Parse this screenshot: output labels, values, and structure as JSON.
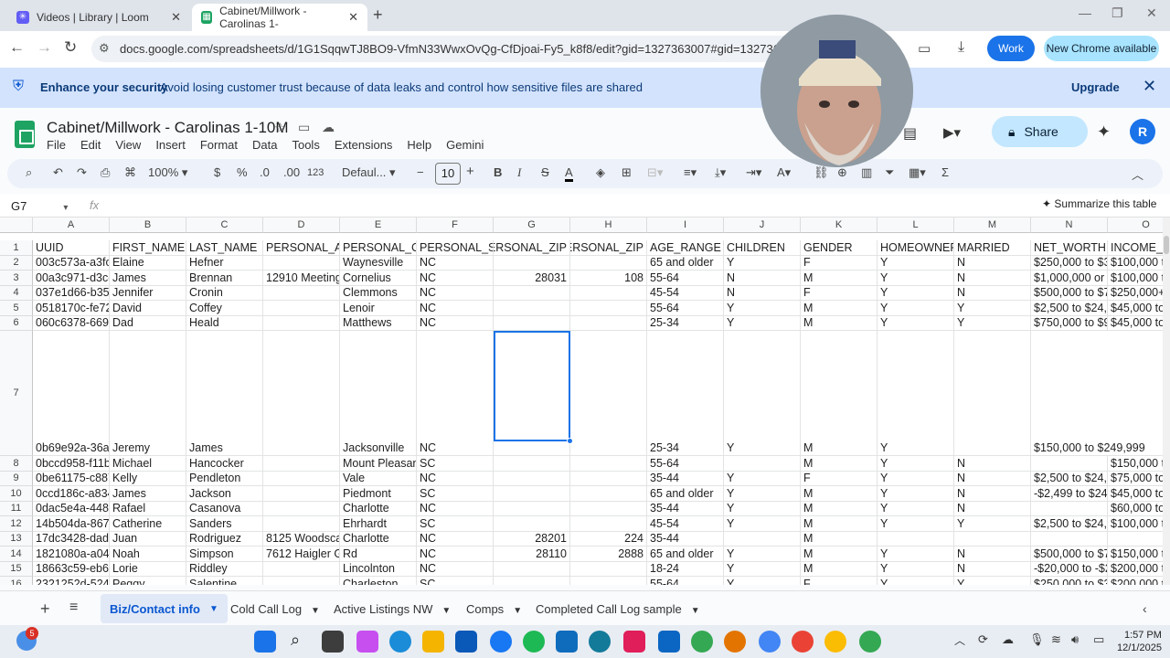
{
  "browser": {
    "tabs": [
      {
        "title": "Videos | Library | Loom"
      },
      {
        "title": "Cabinet/Millwork - Carolinas 1-"
      }
    ],
    "url": "docs.google.com/spreadsheets/d/1G1SqqwTJ8BO9-VfmN33WwxOvQg-CfDjoai-Fy5_k8f8/edit?gid=1327363007#gid=1327363007",
    "work_label": "Work",
    "new_chrome_label": "New Chrome available"
  },
  "security_banner": {
    "title": "Enhance your security",
    "text": "Avoid losing customer trust because of data leaks and control how sensitive files are shared",
    "upgrade_label": "Upgrade"
  },
  "doc": {
    "title": "Cabinet/Millwork - Carolinas 1-10M",
    "menus": [
      "File",
      "Edit",
      "View",
      "Insert",
      "Format",
      "Data",
      "Tools",
      "Extensions",
      "Help",
      "Gemini"
    ],
    "share_label": "Share",
    "avatar_letter": "R"
  },
  "toolbar": {
    "zoom": "100%",
    "currency": "$",
    "percent": "%",
    "dec_decrease": ".0",
    "dec_increase": ".00",
    "number_format": "123",
    "font": "Defaul...",
    "font_size": "10"
  },
  "formula_bar": {
    "name_box": "G7",
    "fx": "fx",
    "summarize_label": "Summarize this table"
  },
  "grid": {
    "columns": [
      "A",
      "B",
      "C",
      "D",
      "E",
      "F",
      "G",
      "H",
      "I",
      "J",
      "K",
      "L",
      "M",
      "N",
      "O"
    ],
    "rows": [
      {
        "n": "1",
        "cells": [
          "UUID",
          "FIRST_NAME",
          "LAST_NAME",
          "PERSONAL_AD",
          "PERSONAL_CI",
          "PERSONAL_ST",
          "PERSONAL_ZIP",
          "PERSONAL_ZIP",
          "AGE_RANGE",
          "CHILDREN",
          "GENDER",
          "HOMEOWNER",
          "MARRIED",
          "NET_WORTH",
          "INCOME_I"
        ]
      },
      {
        "n": "2",
        "cells": [
          "003c573a-a3fc-5",
          "Elaine",
          "Hefner",
          "",
          "Waynesville",
          "NC",
          "",
          "",
          "65 and older",
          "Y",
          "F",
          "Y",
          "N",
          "$250,000 to $37",
          "$100,000 t"
        ]
      },
      {
        "n": "3",
        "cells": [
          "00a3c971-d3ce-",
          "James",
          "Brennan",
          "12910 Meetingh",
          "Cornelius",
          "NC",
          "28031",
          "108",
          "55-64",
          "N",
          "M",
          "Y",
          "N",
          "$1,000,000 or m",
          "$100,000 t"
        ]
      },
      {
        "n": "4",
        "cells": [
          "037e1d66-b354-",
          "Jennifer",
          "Cronin",
          "",
          "Clemmons",
          "NC",
          "",
          "",
          "45-54",
          "N",
          "F",
          "Y",
          "N",
          "$500,000 to $74",
          "$250,000+"
        ]
      },
      {
        "n": "5",
        "cells": [
          "0518170c-fe72-5",
          "David",
          "Coffey",
          "",
          "Lenoir",
          "NC",
          "",
          "",
          "55-64",
          "Y",
          "M",
          "Y",
          "Y",
          "$2,500 to $24,9",
          "$45,000 to"
        ]
      },
      {
        "n": "6",
        "cells": [
          "060c6378-6694-",
          "Dad",
          "Heald",
          "",
          "Matthews",
          "NC",
          "",
          "",
          "25-34",
          "Y",
          "M",
          "Y",
          "Y",
          "$750,000 to $99",
          "$45,000 to"
        ]
      },
      {
        "n": "7",
        "cells": [
          "0b69e92a-36a4-",
          "Jeremy",
          "James",
          "",
          "Jacksonville",
          "NC",
          "",
          "",
          "25-34",
          "Y",
          "M",
          "Y",
          "",
          "$150,000 to $249,999",
          ""
        ]
      },
      {
        "n": "8",
        "cells": [
          "0bccd958-f11b-5",
          "Michael",
          "Hancocker",
          "",
          "Mount Pleasant",
          "SC",
          "",
          "",
          "55-64",
          "",
          "M",
          "Y",
          "N",
          "",
          "$150,000 t"
        ]
      },
      {
        "n": "9",
        "cells": [
          "0be61175-c887-",
          "Kelly",
          "Pendleton",
          "",
          "Vale",
          "NC",
          "",
          "",
          "35-44",
          "Y",
          "F",
          "Y",
          "N",
          "$2,500 to $24,9",
          "$75,000 to"
        ]
      },
      {
        "n": "10",
        "cells": [
          "0ccd186c-a834-",
          "James",
          "Jackson",
          "",
          "Piedmont",
          "SC",
          "",
          "",
          "65 and older",
          "Y",
          "M",
          "Y",
          "N",
          "-$2,499 to $24,9",
          "$45,000 to"
        ]
      },
      {
        "n": "11",
        "cells": [
          "0dac5e4a-448e-",
          "Rafael",
          "Casanova",
          "",
          "Charlotte",
          "NC",
          "",
          "",
          "35-44",
          "Y",
          "M",
          "Y",
          "N",
          "",
          "$60,000 to"
        ]
      },
      {
        "n": "12",
        "cells": [
          "14b504da-8675-",
          "Catherine",
          "Sanders",
          "",
          "Ehrhardt",
          "SC",
          "",
          "",
          "45-54",
          "Y",
          "M",
          "Y",
          "Y",
          "$2,500 to $24,9",
          "$100,000 t"
        ]
      },
      {
        "n": "13",
        "cells": [
          "17dc3428-dad7-",
          "Juan",
          "Rodriguez",
          "8125 Woodscap",
          "Charlotte",
          "NC",
          "28201",
          "224",
          "35-44",
          "",
          "M",
          "",
          "",
          "",
          ""
        ]
      },
      {
        "n": "14",
        "cells": [
          "1821080a-a04d-",
          "Noah",
          "Simpson",
          "7612 Haigler Gin",
          "Rd",
          "NC",
          "28110",
          "2888",
          "65 and older",
          "Y",
          "M",
          "Y",
          "N",
          "$500,000 to $74",
          "$150,000 t"
        ]
      },
      {
        "n": "15",
        "cells": [
          "18663c59-eb6d-",
          "Lorie",
          "Riddley",
          "",
          "Lincolnton",
          "NC",
          "",
          "",
          "18-24",
          "Y",
          "M",
          "Y",
          "N",
          "-$20,000 to -$2,5",
          "$200,000 t"
        ]
      },
      {
        "n": "16",
        "cells": [
          "2321252d-5249-",
          "Peggy",
          "Salentine",
          "",
          "Charleston",
          "SC",
          "",
          "",
          "55-64",
          "Y",
          "F",
          "Y",
          "Y",
          "$250,000 to $37",
          "$200,000 t"
        ]
      },
      {
        "n": "17",
        "cells": [
          "247c5c19-69da-",
          "Christopher",
          "Grindberg",
          "",
          "Charleston",
          "SC",
          "",
          "",
          "",
          "",
          "M",
          "",
          "",
          "",
          "$100,000 t"
        ]
      }
    ]
  },
  "sheet_tabs": [
    "Biz/Contact info",
    "Cold Call Log",
    "Active Listings NW",
    "Comps",
    "Completed Call Log sample"
  ],
  "taskbar": {
    "time": "1:57 PM",
    "date": "12/1/2025",
    "badge": "5"
  },
  "colors": {
    "accent": "#1a73e8",
    "sheets_green": "#1ea362",
    "banner": "#d3e3fd"
  }
}
